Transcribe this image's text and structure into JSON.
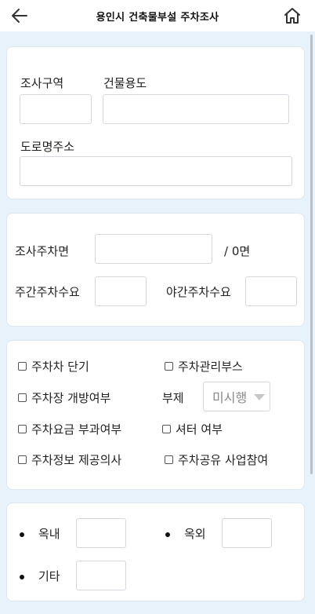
{
  "header": {
    "title": "용인시 건축물부설 주차조사",
    "back_icon": "arrow-left-icon",
    "home_icon": "home-icon"
  },
  "section1": {
    "survey_area_label": "조사구역",
    "building_use_label": "건물용도",
    "road_address_label": "도로명주소",
    "survey_area_value": "",
    "building_use_value": "",
    "road_address_value": ""
  },
  "section2": {
    "parking_area_label": "조사주차면",
    "parking_area_value": "",
    "total_suffix": "/ 0면",
    "day_demand_label": "주간주차수요",
    "day_demand_value": "",
    "night_demand_label": "야간주차수요",
    "night_demand_value": ""
  },
  "section3": {
    "checkboxes": [
      "주차차 단기",
      "주차관리부스",
      "주차장 개방여부",
      "주차요금 부과여부",
      "셔터 여부",
      "주차정보 제공의사",
      "주차공유 사업참여"
    ],
    "subsidiary_label": "부제",
    "subsidiary_selected": "미시행"
  },
  "section4": {
    "indoor_label": "옥내",
    "outdoor_label": "옥외",
    "other_label": "기타",
    "indoor_value": "",
    "outdoor_value": "",
    "other_value": ""
  }
}
